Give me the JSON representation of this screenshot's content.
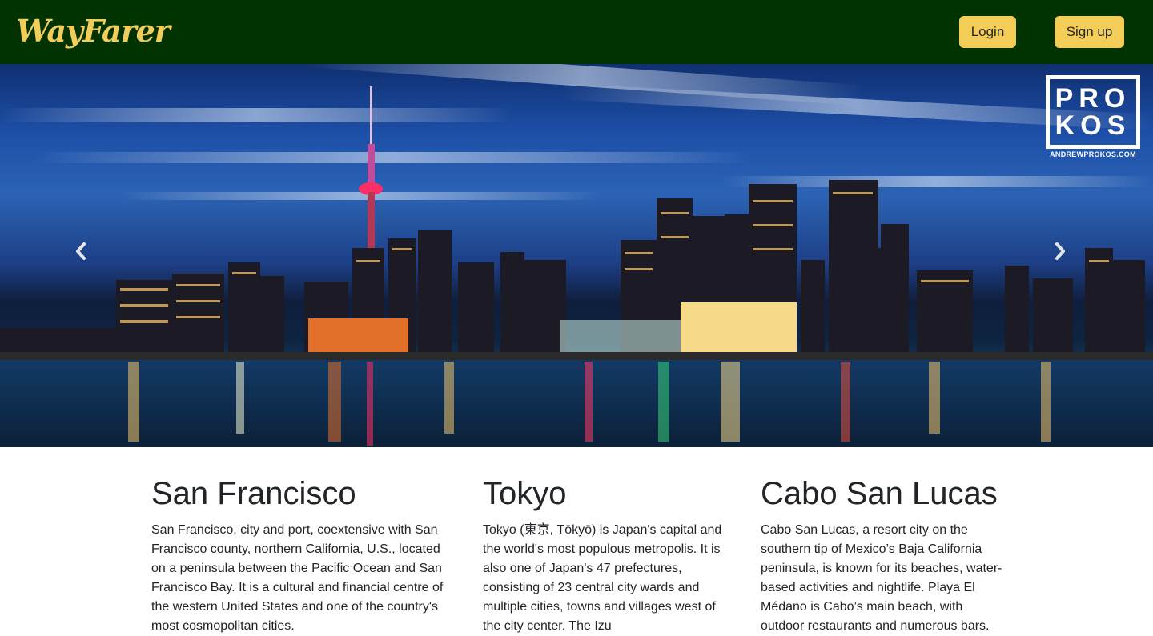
{
  "navbar": {
    "brand": "WayFarer",
    "login_label": "Login",
    "signup_label": "Sign up",
    "background_color": "#013300",
    "accent_color": "#f4cd56"
  },
  "carousel": {
    "prev_icon": "chevron-left-icon",
    "next_icon": "chevron-right-icon",
    "watermark": {
      "line1": "PRO",
      "line2": "KOS",
      "url": "ANDREWPROKOS.COM"
    }
  },
  "cities": [
    {
      "name": "San Francisco",
      "description": "San Francisco, city and port, coextensive with San Francisco county, northern California, U.S., located on a peninsula between the Pacific Ocean and San Francisco Bay. It is a cultural and financial centre of the western United States and one of the country's most cosmopolitan cities."
    },
    {
      "name": "Tokyo",
      "description": "Tokyo (東京, Tōkyō) is Japan's capital and the world's most populous metropolis. It is also one of Japan's 47 prefectures, consisting of 23 central city wards and multiple cities, towns and villages west of the city center. The Izu"
    },
    {
      "name": "Cabo San Lucas",
      "description": "Cabo San Lucas, a resort city on the southern tip of Mexico’s Baja California peninsula, is known for its beaches, water-based activities and nightlife. Playa El Médano is Cabo’s main beach, with outdoor restaurants and numerous bars."
    }
  ]
}
